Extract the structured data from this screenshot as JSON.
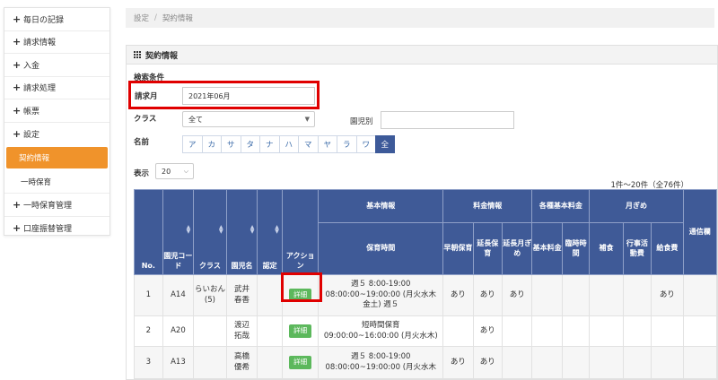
{
  "sidebar": {
    "items": [
      {
        "label": "毎日の記録"
      },
      {
        "label": "請求情報"
      },
      {
        "label": "入金"
      },
      {
        "label": "請求処理"
      },
      {
        "label": "帳票"
      },
      {
        "label": "設定"
      }
    ],
    "sub_items": [
      {
        "label": "契約情報"
      },
      {
        "label": "一時保育"
      }
    ],
    "after_items": [
      {
        "label": "一時保育管理"
      },
      {
        "label": "口座振替管理"
      }
    ]
  },
  "breadcrumb": {
    "root": "設定",
    "separator": "/",
    "current": "契約情報"
  },
  "panel": {
    "title": "契約情報"
  },
  "search": {
    "section_label": "検索条件",
    "month_label": "請求月",
    "month_value": "2021年06月",
    "class_label": "クラス",
    "class_value": "全て",
    "child_label": "園児別",
    "child_value": "",
    "name_label": "名前",
    "kana": [
      "ア",
      "カ",
      "サ",
      "タ",
      "ナ",
      "ハ",
      "マ",
      "ヤ",
      "ラ",
      "ワ",
      "全"
    ],
    "kana_selected": "全",
    "show_label": "表示",
    "show_value": "20"
  },
  "count_text": "1件～20件（全76件）",
  "table": {
    "group_headers": {
      "basic": "基本情報",
      "fees": "料金情報",
      "various": "各種基本料金",
      "monthly": "月ぎめ"
    },
    "headers": {
      "no": "No.",
      "code": "園児コード",
      "class": "クラス",
      "name": "園児名",
      "approve": "認定",
      "action": "アクション",
      "hours": "保育時間",
      "early": "早朝保育",
      "extend": "延長保育",
      "extend_monthly": "延長月ぎめ",
      "base_fee": "基本料金",
      "temp_hours": "臨時時間",
      "meal": "補食",
      "event_fee": "行事活動費",
      "lunch_fee": "給食費",
      "commute": "通信欄"
    },
    "detail_label": "詳細",
    "rows": [
      {
        "no": "1",
        "code": "A14",
        "class": "らいおん(5)",
        "name": "武井春香",
        "approve": "",
        "hours": [
          "週５ 8:00-19:00",
          "08:00:00~19:00:00 (月火水木",
          "金土) 週５"
        ],
        "early": "あり",
        "extend": "あり",
        "extend_monthly": "あり",
        "base_fee": "",
        "temp_hours": "",
        "meal": "",
        "event_fee": "",
        "lunch_fee": "あり",
        "commute": ""
      },
      {
        "no": "2",
        "code": "A20",
        "class": "",
        "name": "渡辺拓哉",
        "approve": "",
        "hours": [
          "短時間保育",
          "09:00:00~16:00:00 (月火水木)"
        ],
        "early": "",
        "extend": "あり",
        "extend_monthly": "",
        "base_fee": "",
        "temp_hours": "",
        "meal": "",
        "event_fee": "",
        "lunch_fee": "",
        "commute": ""
      },
      {
        "no": "3",
        "code": "A13",
        "class": "",
        "name": "高橋優希",
        "approve": "",
        "hours": [
          "週５ 8:00-19:00",
          "08:00:00~19:00:00 (月火水木"
        ],
        "early": "あり",
        "extend": "あり",
        "extend_monthly": "",
        "base_fee": "",
        "temp_hours": "",
        "meal": "",
        "event_fee": "",
        "lunch_fee": "",
        "commute": ""
      }
    ]
  }
}
